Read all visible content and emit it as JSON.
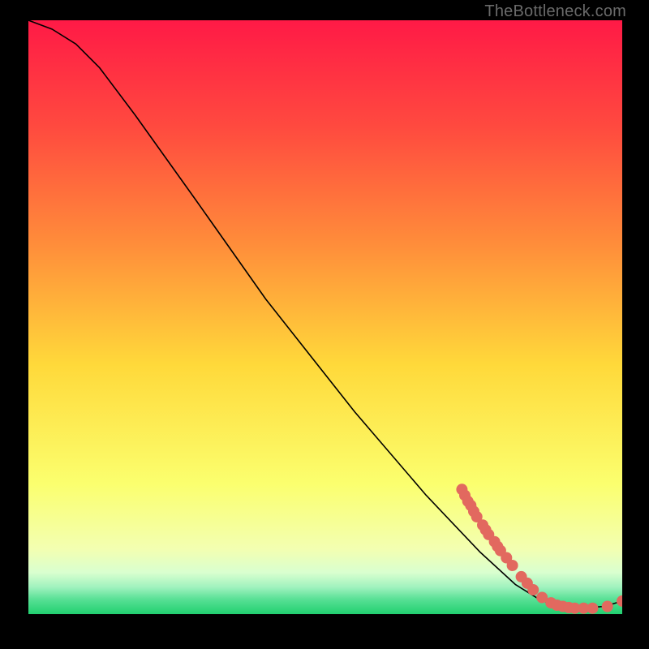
{
  "branding": "TheBottleneck.com",
  "chart_data": {
    "type": "line",
    "title": "",
    "xlabel": "",
    "ylabel": "",
    "xlim": [
      0,
      100
    ],
    "ylim": [
      0,
      100
    ],
    "grid": false,
    "legend": false,
    "background_gradient": {
      "top": "#ff1a46",
      "upper": "#ff663f",
      "mid": "#ffd93a",
      "lower_yellow": "#fbff6e",
      "pale": "#f3ffb1",
      "mint": "#77f2a6",
      "green": "#21d070"
    },
    "curve": {
      "comment": "black curve: y vs x (percent of plotting area, origin bottom-left)",
      "points": [
        {
          "x": 0,
          "y": 100
        },
        {
          "x": 4,
          "y": 98.5
        },
        {
          "x": 8,
          "y": 96
        },
        {
          "x": 12,
          "y": 92
        },
        {
          "x": 18,
          "y": 84
        },
        {
          "x": 28,
          "y": 70
        },
        {
          "x": 40,
          "y": 53
        },
        {
          "x": 55,
          "y": 34
        },
        {
          "x": 67,
          "y": 20
        },
        {
          "x": 76,
          "y": 10.5
        },
        {
          "x": 82,
          "y": 5
        },
        {
          "x": 86,
          "y": 2.5
        },
        {
          "x": 89,
          "y": 1.4
        },
        {
          "x": 93,
          "y": 1.0
        },
        {
          "x": 97,
          "y": 1.3
        },
        {
          "x": 100,
          "y": 2.2
        }
      ]
    },
    "markers": {
      "comment": "salmon scatter markers clustered near trough (percent, origin bottom-left)",
      "color": "#e2695f",
      "radius": 7,
      "points": [
        {
          "x": 73,
          "y": 21
        },
        {
          "x": 73.5,
          "y": 20
        },
        {
          "x": 74,
          "y": 19
        },
        {
          "x": 74.5,
          "y": 18.3
        },
        {
          "x": 75,
          "y": 17.3
        },
        {
          "x": 75.5,
          "y": 16.4
        },
        {
          "x": 76.5,
          "y": 15
        },
        {
          "x": 77,
          "y": 14.2
        },
        {
          "x": 77.5,
          "y": 13.4
        },
        {
          "x": 78.5,
          "y": 12.2
        },
        {
          "x": 79,
          "y": 11.4
        },
        {
          "x": 79.5,
          "y": 10.7
        },
        {
          "x": 80.5,
          "y": 9.5
        },
        {
          "x": 81.5,
          "y": 8.2
        },
        {
          "x": 83,
          "y": 6.3
        },
        {
          "x": 84,
          "y": 5.2
        },
        {
          "x": 85,
          "y": 4.1
        },
        {
          "x": 86.5,
          "y": 2.8
        },
        {
          "x": 88,
          "y": 1.9
        },
        {
          "x": 89,
          "y": 1.5
        },
        {
          "x": 90,
          "y": 1.3
        },
        {
          "x": 91,
          "y": 1.1
        },
        {
          "x": 92,
          "y": 1.0
        },
        {
          "x": 93.5,
          "y": 1.0
        },
        {
          "x": 95,
          "y": 1.0
        },
        {
          "x": 97.5,
          "y": 1.3
        },
        {
          "x": 100,
          "y": 2.2
        }
      ]
    }
  }
}
